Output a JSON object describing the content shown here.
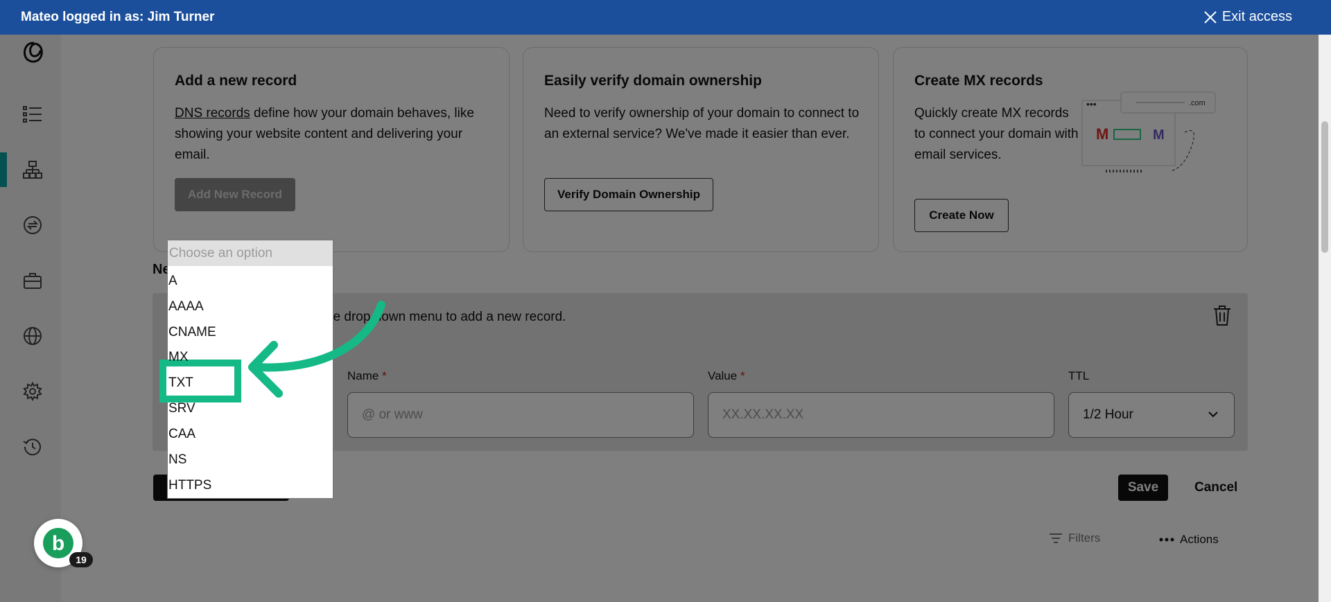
{
  "banner": {
    "logged_in_text": "Mateo logged in as: Jim Turner",
    "exit_label": "Exit access"
  },
  "sidebar": {
    "items": [
      {
        "icon": "list-icon"
      },
      {
        "icon": "dns-hierarchy-icon",
        "active": true
      },
      {
        "icon": "transfer-icon"
      },
      {
        "icon": "briefcase-icon"
      },
      {
        "icon": "globe-icon"
      },
      {
        "icon": "gear-icon"
      },
      {
        "icon": "history-icon"
      }
    ]
  },
  "cards": [
    {
      "title": "Add a new record",
      "link_text": "DNS records",
      "body_rest": " define how your domain behaves, like showing your website content and delivering your email.",
      "button": "Add New Record"
    },
    {
      "title": "Easily verify domain ownership",
      "body": "Need to verify ownership of your domain to connect to an external service? We've made it easier than ever.",
      "button": "Verify Domain Ownership"
    },
    {
      "title": "Create MX records",
      "body": "Quickly create MX records to connect your domain with email services.",
      "button": "Create Now",
      "illustration_domain": ".com"
    }
  ],
  "new_record": {
    "section_label_visible": "Ne",
    "hint_visible": "he drop down menu to add a new record.",
    "fields": {
      "name_label": "Name",
      "name_placeholder": "@ or www",
      "value_label": "Value",
      "value_placeholder": "XX.XX.XX.XX",
      "ttl_label": "TTL",
      "ttl_value": "1/2 Hour",
      "required_mark": "*"
    },
    "save_label": "Save",
    "cancel_label": "Cancel"
  },
  "dropdown": {
    "placeholder": "Choose an option",
    "options": [
      "A",
      "AAAA",
      "CNAME",
      "MX",
      "TXT",
      "SRV",
      "CAA",
      "NS",
      "HTTPS"
    ],
    "highlighted": "TXT"
  },
  "toolbar": {
    "filters_label": "Filters",
    "actions_label": "Actions"
  },
  "assistant_badge": {
    "letter": "b",
    "count": "19"
  },
  "colors": {
    "banner": "#1b4f9c",
    "highlight": "#14b985",
    "active_nav": "#0aa3a3"
  }
}
